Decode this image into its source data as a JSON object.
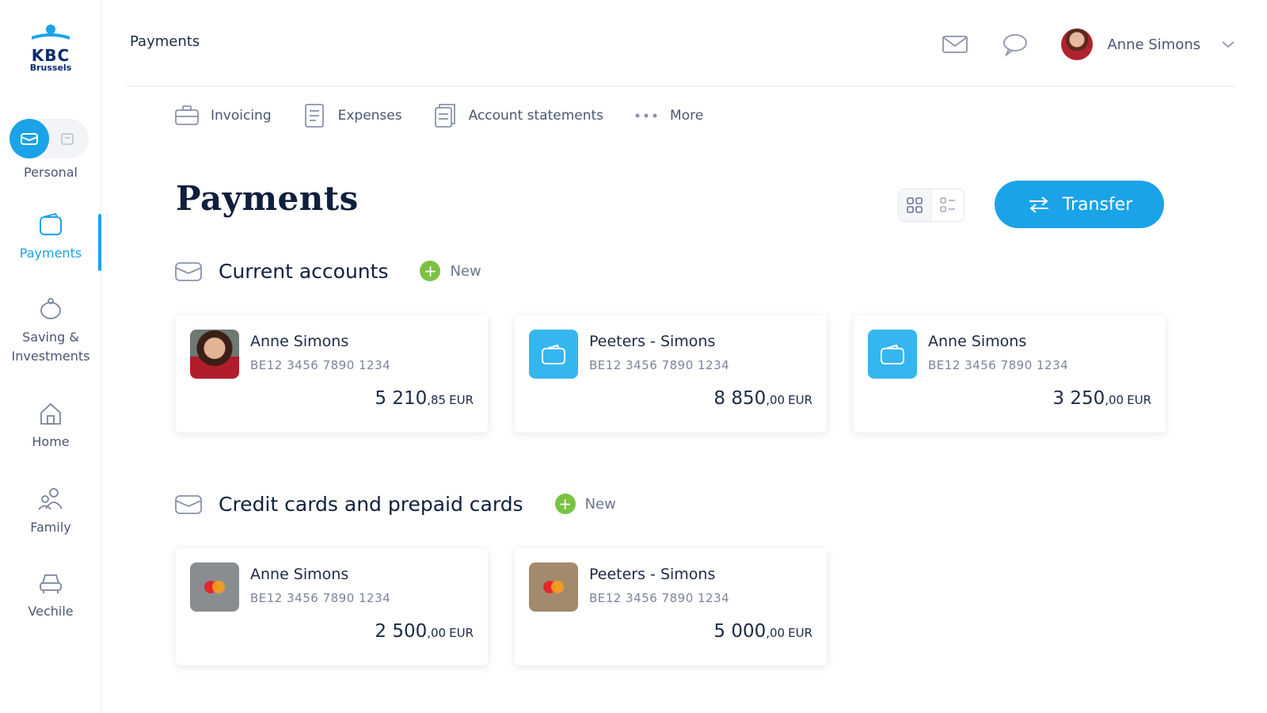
{
  "brand": {
    "logo_text": "KBC",
    "logo_sub": "Brussels"
  },
  "sidebar": {
    "mode_label": "Personal",
    "items": [
      {
        "label": "Payments",
        "icon": "wallet-icon",
        "active": true
      },
      {
        "label": "Saving & Investments",
        "icon": "piggy-bank-icon",
        "active": false
      },
      {
        "label": "Home",
        "icon": "home-icon",
        "active": false
      },
      {
        "label": "Family",
        "icon": "family-icon",
        "active": false
      },
      {
        "label": "Vechile",
        "icon": "car-icon",
        "active": false
      }
    ]
  },
  "header": {
    "breadcrumb": "Payments",
    "user_name": "Anne Simons",
    "icons": [
      "mail-icon",
      "chat-icon",
      "avatar",
      "chevron-down-icon"
    ]
  },
  "subnav": {
    "items": [
      {
        "label": "Invoicing",
        "icon": "briefcase-icon"
      },
      {
        "label": "Expenses",
        "icon": "receipt-icon"
      },
      {
        "label": "Account statements",
        "icon": "statement-icon"
      },
      {
        "label": "More",
        "icon": "more-dots-icon"
      }
    ]
  },
  "main": {
    "title": "Payments",
    "transfer_label": "Transfer",
    "view_modes": [
      "grid-view-icon",
      "list-view-icon"
    ],
    "sections": [
      {
        "title": "Current accounts",
        "new_label": "New",
        "cards": [
          {
            "name": "Anne Simons",
            "iban": "BE12 3456 7890 1234",
            "amount_int": "5 210",
            "amount_dec": ",85",
            "currency": "EUR",
            "thumb": "photo"
          },
          {
            "name": "Peeters - Simons",
            "iban": "BE12 3456 7890 1234",
            "amount_int": "8 850",
            "amount_dec": ",00",
            "currency": "EUR",
            "thumb": "blue"
          },
          {
            "name": "Anne Simons",
            "iban": "BE12 3456 7890 1234",
            "amount_int": "3 250",
            "amount_dec": ",00",
            "currency": "EUR",
            "thumb": "blue"
          }
        ]
      },
      {
        "title": "Credit cards and prepaid cards",
        "new_label": "New",
        "cards": [
          {
            "name": "Anne Simons",
            "iban": "BE12 3456 7890 1234",
            "amount_int": "2 500",
            "amount_dec": ",00",
            "currency": "EUR",
            "thumb": "gray"
          },
          {
            "name": "Peeters - Simons",
            "iban": "BE12 3456 7890 1234",
            "amount_int": "5 000",
            "amount_dec": ",00",
            "currency": "EUR",
            "thumb": "brown"
          }
        ]
      }
    ]
  },
  "colors": {
    "accent": "#1aa3e8",
    "new_green": "#7ac242",
    "heading": "#0f1f3d"
  }
}
